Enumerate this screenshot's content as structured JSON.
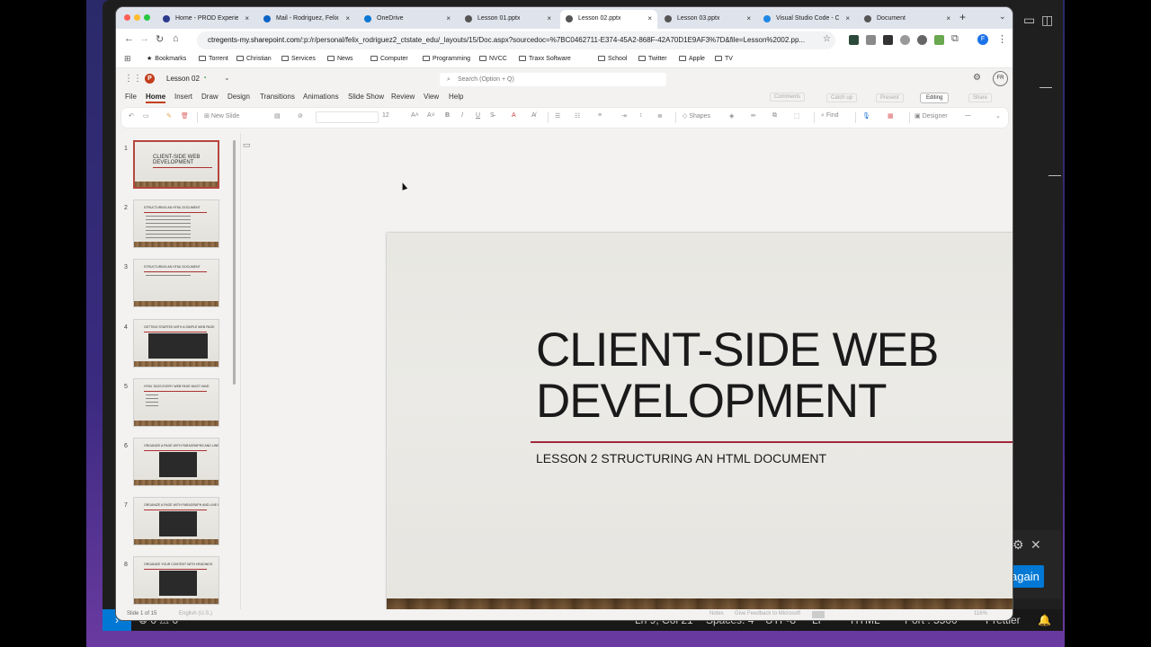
{
  "browser": {
    "tabs": [
      {
        "label": "Home - PROD Experien",
        "favicon_color": "#2b3a8c"
      },
      {
        "label": "Mail - Rodriguez, Felix",
        "favicon_color": "#0a64c8"
      },
      {
        "label": "OneDrive",
        "favicon_color": "#0a78d4"
      },
      {
        "label": "Lesson 01.pptx",
        "favicon_color": "#555555"
      },
      {
        "label": "Lesson 02.pptx",
        "favicon_color": "#555555"
      },
      {
        "label": "Lesson 03.pptx",
        "favicon_color": "#555555"
      },
      {
        "label": "Visual Studio Code - C",
        "favicon_color": "#1e88e5"
      },
      {
        "label": "Document",
        "favicon_color": "#555555"
      }
    ],
    "close_glyph": "×",
    "new_tab_glyph": "+",
    "url_host": "ctregents-my.sharepoint.com",
    "url_path": "/:p:/r/personal/felix_rodriguez2_ctstate_edu/_layouts/15/Doc.aspx?sourcedoc=%7BC0462711-E374-45A2-868F-42A70D1E9AF3%7D&file=Lesson%2002.pp...",
    "profile_initial": "F",
    "bookmarks": [
      "Bookmarks",
      "Torrent",
      "Christian",
      "Services",
      "News",
      "Computer",
      "Programming",
      "NVCC",
      "Traxx Software",
      "School",
      "Twitter",
      "Apple",
      "TV"
    ]
  },
  "office": {
    "doc_title": "Lesson 02",
    "search_placeholder": "Search (Option + Q)",
    "user_initials": "FR",
    "tabs": [
      "File",
      "Home",
      "Insert",
      "Draw",
      "Design",
      "Transitions",
      "Animations",
      "Slide Show",
      "Review",
      "View",
      "Help"
    ],
    "active_tab": "Home",
    "top_buttons": {
      "comments": "Comments",
      "catchup": "Catch up",
      "present": "Present",
      "editing": "Editing",
      "share": "Share"
    },
    "ribbon": {
      "new_slide": "New Slide",
      "font_size": "12",
      "shapes": "Shapes",
      "find": "Find",
      "designer": "Designer"
    },
    "thumbnails": [
      {
        "num": "1",
        "title": "CLIENT-SIDE WEB DEVELOPMENT"
      },
      {
        "num": "2",
        "title": "STRUCTURING AN HTML DOCUMENT"
      },
      {
        "num": "3",
        "title": "STRUCTURING AN HTML DOCUMENT"
      },
      {
        "num": "4",
        "title": "GETTING STARTED WITH A SIMPLE WEB PAGE"
      },
      {
        "num": "5",
        "title": "HTML TAGS EVERY WEB PAGE MUST HAVE"
      },
      {
        "num": "6",
        "title": "ORGANIZE A PAGE WITH PARAGRAPHS AND LINE BREAKS"
      },
      {
        "num": "7",
        "title": "ORGANIZE A PAGE WITH PARAGRAPH AND LINE BREAKS"
      },
      {
        "num": "8",
        "title": "ORGANIZE YOUR CONTENT WITH HEADINGS"
      }
    ],
    "slide": {
      "title_line1": "CLIENT-SIDE WEB",
      "title_line2": "DEVELOPMENT",
      "subtitle": "LESSON 2 STRUCTURING AN HTML DOCUMENT",
      "accent_color": "#a3273a"
    },
    "status": {
      "slide_count": "Slide 1 of 15",
      "language": "English (U.S.)",
      "notes": "Notes",
      "feedback": "Give Feedback to Microsoft",
      "zoom": "116%"
    }
  },
  "vscode": {
    "status": {
      "errors": "0",
      "warnings": "0",
      "position": "Ln 9, Col 21",
      "spaces": "Spaces: 4",
      "encoding": "UTF-8",
      "eol": "LF",
      "language": "HTML",
      "port": "Port : 5500",
      "formatter": "Prettier"
    },
    "toast_button": "again"
  }
}
